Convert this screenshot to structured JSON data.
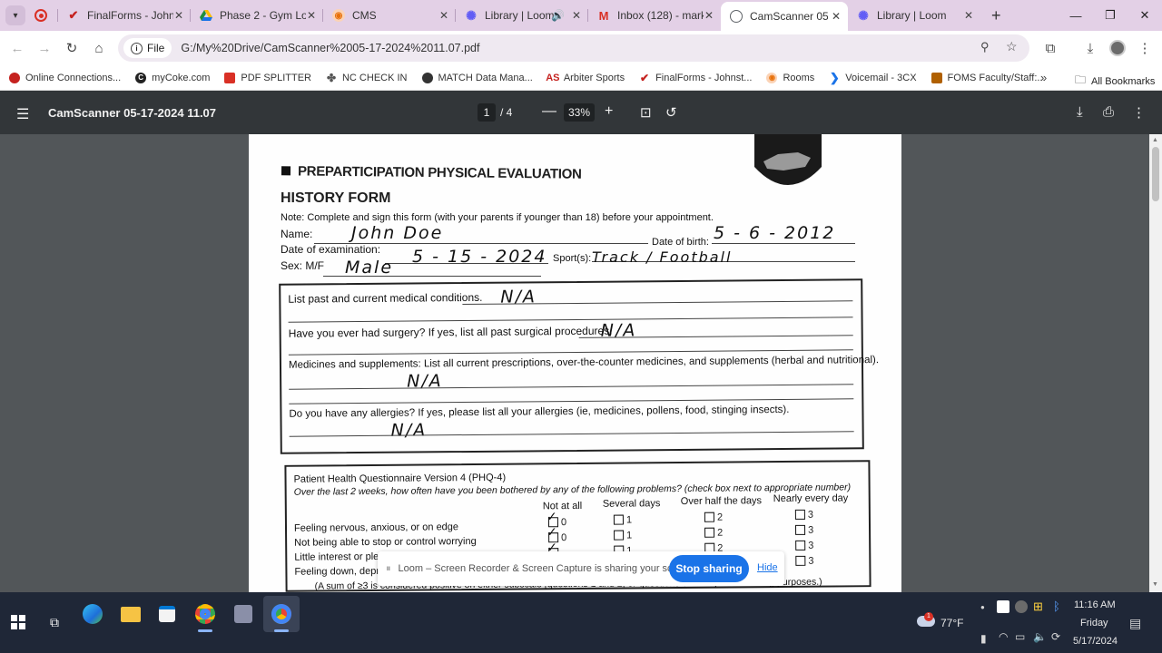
{
  "tabs": [
    {
      "title": "",
      "icon": "record-icon",
      "color": "#d93025"
    },
    {
      "title": "FinalForms - Johnston",
      "icon": "finalforms-icon",
      "color": "#c5221f"
    },
    {
      "title": "Phase 2 - Gym Lobby",
      "icon": "drive-icon",
      "color": "#1e8e3e"
    },
    {
      "title": "CMS",
      "icon": "cms-icon",
      "color": "#e8710a"
    },
    {
      "title": "Library | Loom",
      "icon": "loom-icon",
      "color": "#625df5"
    },
    {
      "title": "Inbox (128) - markm",
      "icon": "gmail-icon",
      "color": "#d93025"
    },
    {
      "title": "CamScanner 05-17",
      "icon": "globe-icon",
      "color": "#5f6368"
    },
    {
      "title": "Library | Loom",
      "icon": "loom-icon",
      "color": "#625df5"
    }
  ],
  "address": {
    "chip": "File",
    "url": "G:/My%20Drive/CamScanner%2005-17-2024%2011.07.pdf"
  },
  "bookmarks": [
    {
      "label": "Online Connections...",
      "color": "#c5221f"
    },
    {
      "label": "myCoke.com",
      "color": "#222222"
    },
    {
      "label": "PDF SPLITTER",
      "color": "#d93025"
    },
    {
      "label": "NC CHECK IN",
      "color": "#555555"
    },
    {
      "label": "MATCH Data Mana...",
      "color": "#333333"
    },
    {
      "label": "Arbiter Sports",
      "color": "#c5221f"
    },
    {
      "label": "FinalForms - Johnst...",
      "color": "#c5221f"
    },
    {
      "label": "Rooms",
      "color": "#e8710a"
    },
    {
      "label": "Voicemail - 3CX",
      "color": "#1a73e8"
    },
    {
      "label": "FOMS Faculty/Staff:...",
      "color": "#b06000"
    }
  ],
  "bookmarks_all": "All Bookmarks",
  "pdf": {
    "title": "CamScanner 05-17-2024 11.07",
    "page": "1",
    "page_total": "/  4",
    "zoom": "33%"
  },
  "form": {
    "heading": "PREPARTICIPATION PHYSICAL EVALUATION",
    "subheading": "HISTORY FORM",
    "note": "Note: Complete and sign this form (with your parents if younger than 18) before your appointment.",
    "name_label": "Name:",
    "name_value": "John  Doe",
    "dob_label": "Date of birth:",
    "dob_value": "5 - 6 - 2012",
    "exam_label": "Date of examination:",
    "exam_value": "5 - 15 - 2024",
    "sport_label": "Sport(s):",
    "sport_value": "Track / Football",
    "sex_label": "Sex: M/F",
    "sex_value": "Male",
    "q_conditions": "List past and current medical conditions.",
    "a_conditions": "N/A",
    "q_surgery": "Have you ever had surgery? If yes, list all past surgical procedures.",
    "a_surgery": "N/A",
    "q_meds": "Medicines and supplements: List all current prescriptions, over-the-counter medicines, and supplements (herbal and nutritional).",
    "a_meds": "N/A",
    "q_allergies": "Do you have any allergies? If yes, please list all your allergies (ie, medicines, pollens, food, stinging insects).",
    "a_allergies": "N/A",
    "phq_title": "Patient Health Questionnaire Version 4 (PHQ-4)",
    "phq_intro": "Over the last 2 weeks, how often have you been bothered by any of the following problems? (check box next to appropriate number)",
    "phq_cols": [
      "Not at all",
      "Several days",
      "Over half the days",
      "Nearly every day"
    ],
    "phq_rows": [
      "Feeling nervous, anxious, or on edge",
      "Not being able to stop or control worrying",
      "Little interest or pleasure in doing things",
      "Feeling down, depressed, or hopeless"
    ],
    "phq_nums": [
      "0",
      "1",
      "2",
      "3"
    ],
    "phq_footer": "(A sum of ≥3 is considered positive on either subscale [questions 1 and 2, or questions 3 and 4] for screening purposes.)"
  },
  "loom": {
    "message": "Loom – Screen Recorder & Screen Capture is sharing your screen.",
    "stop": "Stop sharing",
    "hide": "Hide"
  },
  "taskbar": {
    "weather": "77°F",
    "notification_count": "1",
    "time": "11:16 AM",
    "day": "Friday",
    "date": "5/17/2024"
  }
}
